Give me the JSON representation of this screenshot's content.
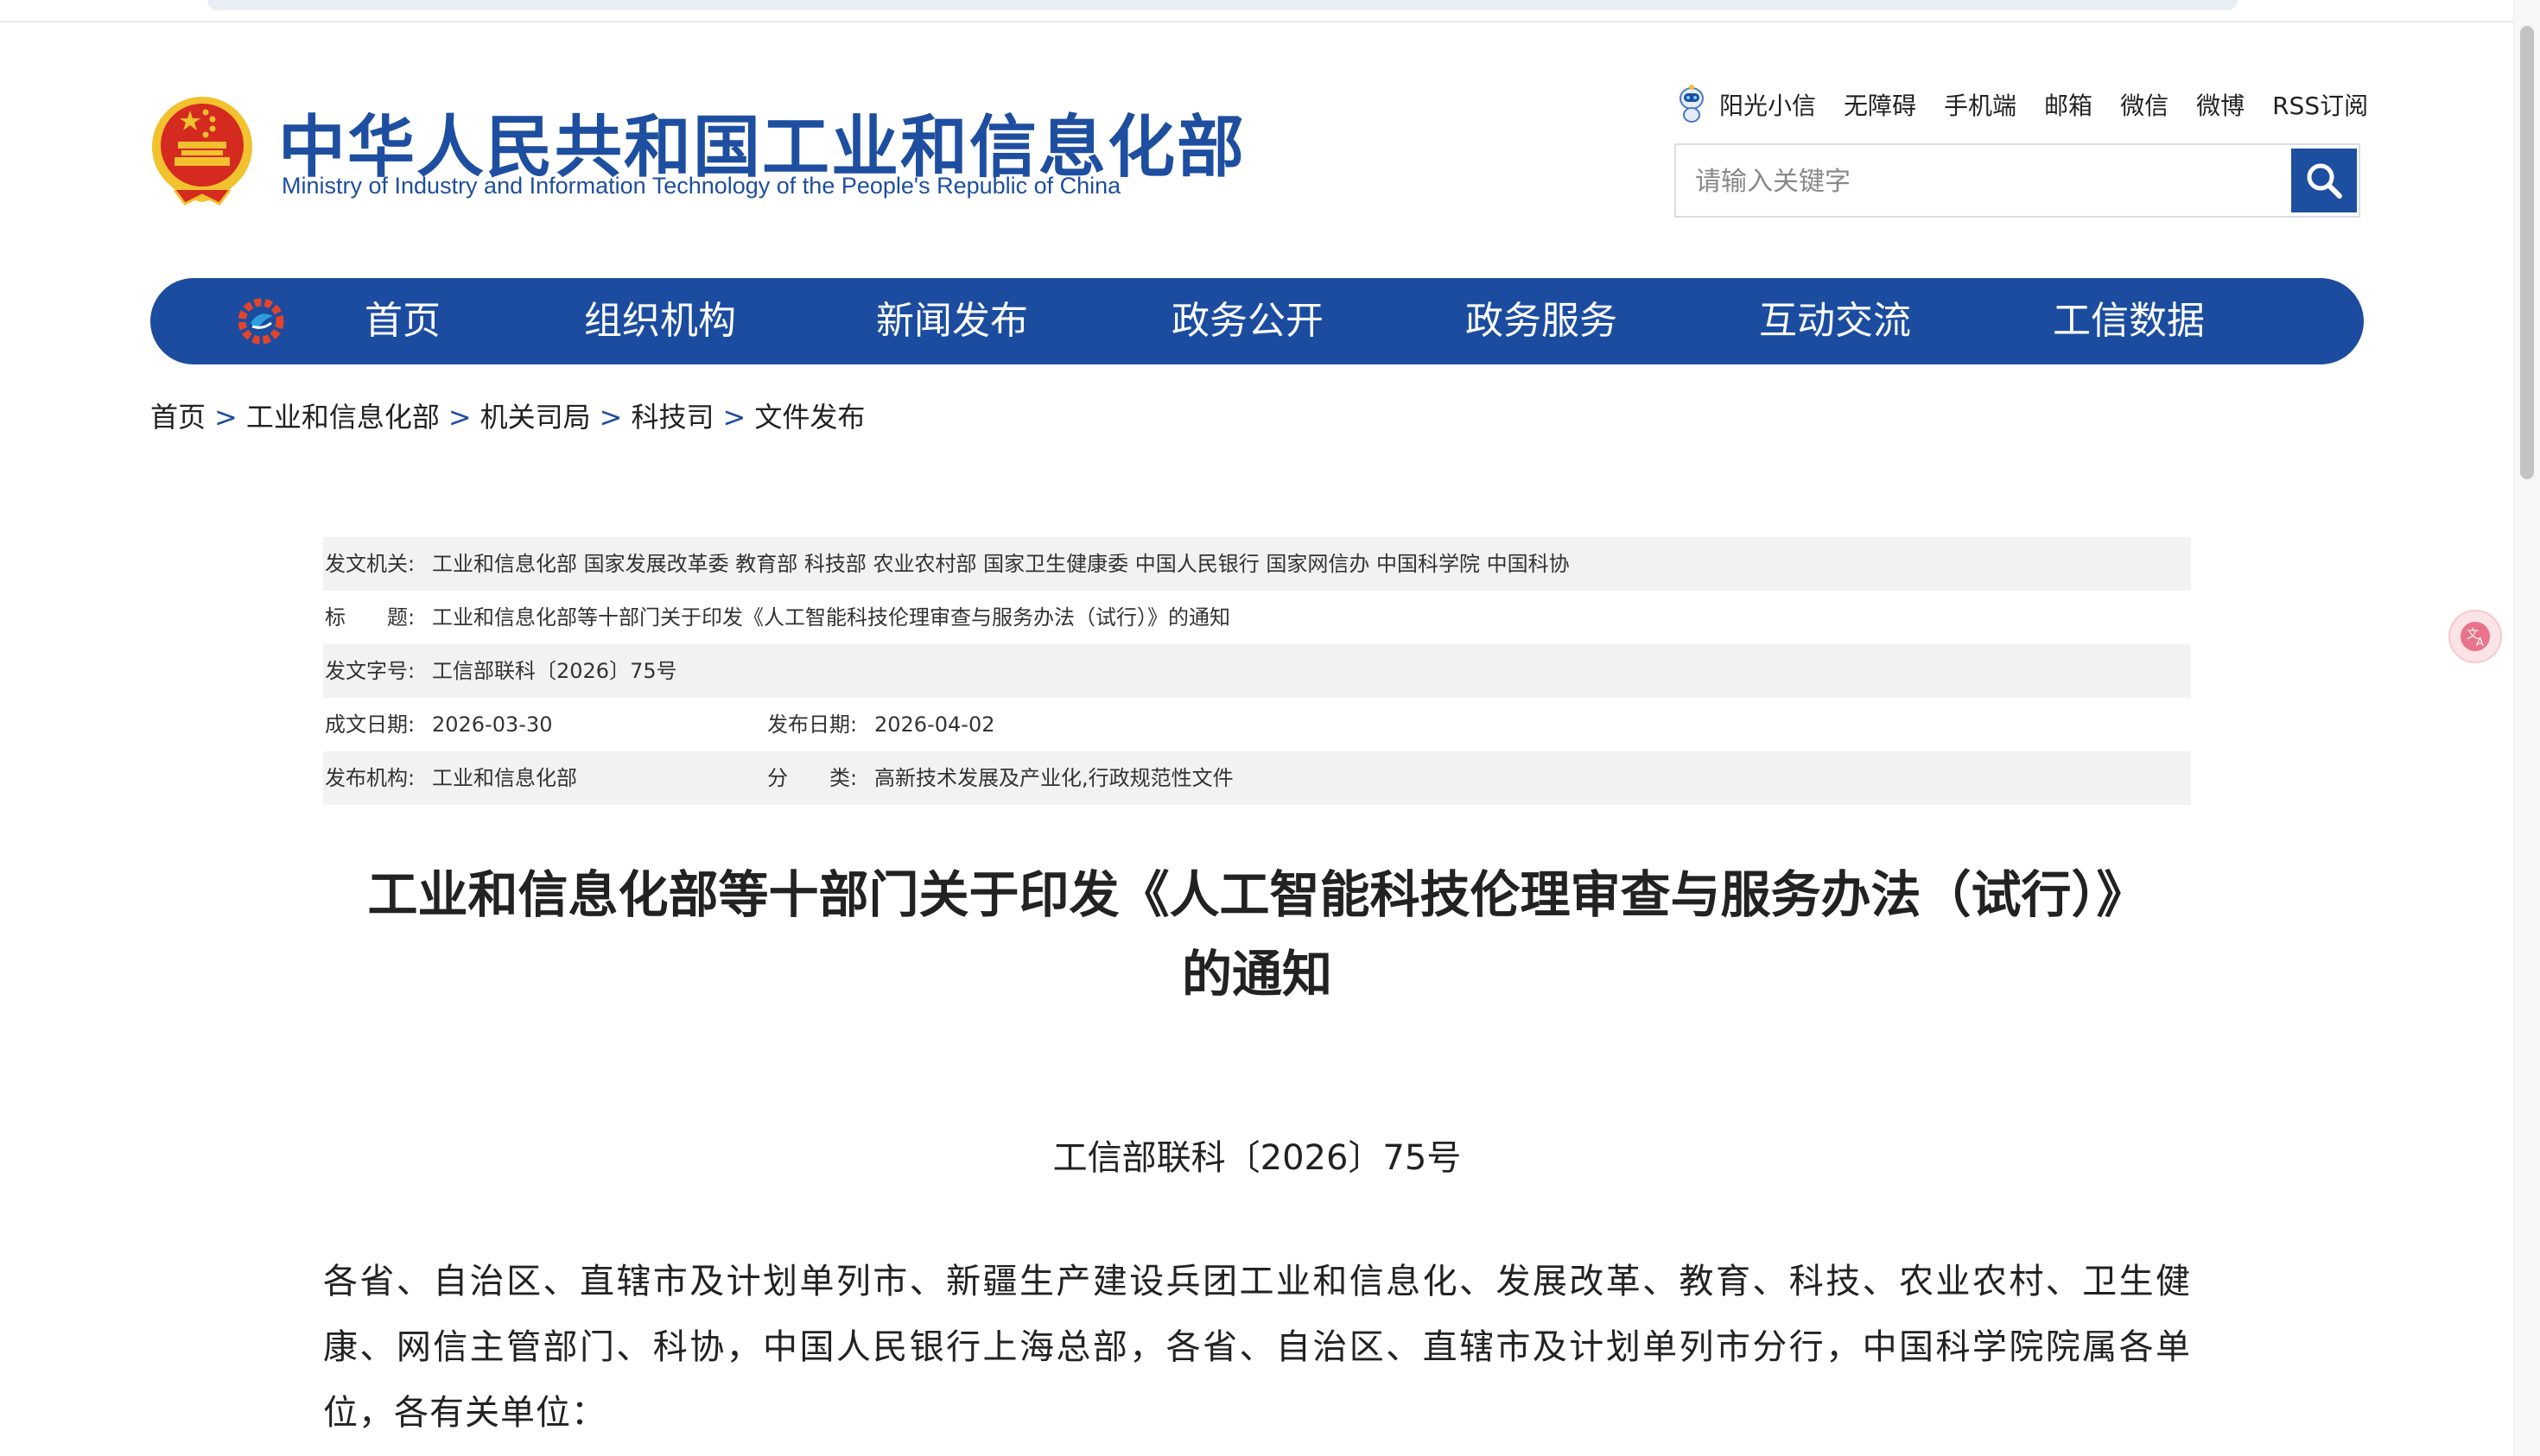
{
  "site": {
    "title": "中华人民共和国工业和信息化部",
    "subtitle": "Ministry of Industry and Information Technology of the People's Republic of China"
  },
  "top_links": [
    "阳光小信",
    "无障碍",
    "手机端",
    "邮箱",
    "微信",
    "微博",
    "RSS订阅"
  ],
  "search": {
    "placeholder": "请输入关键字"
  },
  "nav": {
    "items": [
      "首页",
      "组织机构",
      "新闻发布",
      "政务公开",
      "政务服务",
      "互动交流",
      "工信数据"
    ]
  },
  "breadcrumb": {
    "items": [
      "首页",
      "工业和信息化部",
      "机关司局",
      "科技司",
      "文件发布"
    ],
    "separator": ">"
  },
  "info": {
    "issuer_label": "发文机关:",
    "issuer": "工业和信息化部 国家发展改革委 教育部 科技部 农业农村部 国家卫生健康委 中国人民银行 国家网信办 中国科学院 中国科协",
    "title_label": "标　　题:",
    "title": "工业和信息化部等十部门关于印发《人工智能科技伦理审查与服务办法（试行）》的通知",
    "docno_label": "发文字号:",
    "docno": "工信部联科〔2026〕75号",
    "written_label": "成文日期:",
    "written": "2026-03-30",
    "published_label": "发布日期:",
    "published": "2026-04-02",
    "org_label": "发布机构:",
    "org": "工业和信息化部",
    "category_label": "分　　类:",
    "category": "高新技术发展及产业化,行政规范性文件"
  },
  "article": {
    "title_line1": "工业和信息化部等十部门关于印发《人工智能科技伦理审查与服务办法（试行）》",
    "title_line2": "的通知",
    "doc_number": "工信部联科〔2026〕75号",
    "body": "各省、自治区、直辖市及计划单列市、新疆生产建设兵团工业和信息化、发展改革、教育、科技、农业农村、卫生健康、网信主管部门、科协，中国人民银行上海总部，各省、自治区、直辖市及计划单列市分行，中国科学院院属各单位，各有关单位："
  },
  "colors": {
    "brand_blue": "#1b4c9f",
    "emblem_red": "#d42a1f",
    "emblem_gold": "#f2c12e"
  }
}
